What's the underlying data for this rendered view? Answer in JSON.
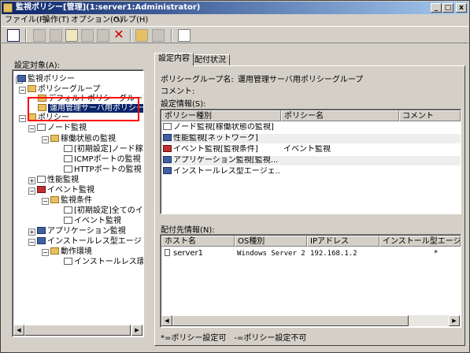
{
  "window": {
    "title": "監視ポリシー[管理](1:server1:Administrator)"
  },
  "menu": [
    "ファイル(F)",
    "操作(T)",
    "オプション(O)",
    "ヘルプ(H)"
  ],
  "left": {
    "label": "設定対象(A):"
  },
  "tree": {
    "root": "監視ポリシー",
    "policy_group": "ポリシーグループ",
    "default_group": "デフォルトポリシーグループ",
    "ops_group": "運用管理サーバ用ポリシー",
    "policy": "ポリシー",
    "node_monitor": "ノード監視",
    "operating": "稼働状態の監視",
    "init_node": "[初期設定]ノード稼",
    "icmp": "ICMPポートの監視",
    "http": "HTTPポートの監視",
    "perf": "性能監視",
    "event": "イベント監視",
    "monitor_cond": "監視条件",
    "init_all": "[初期設定]全てのイ",
    "event_monitor": "イベント監視",
    "app": "アプリケーション監視",
    "install_less": "インストールレス型エージ",
    "action_env": "動作環境",
    "install_less_item": "インストールレス環"
  },
  "tabs": [
    "設定内容",
    "配付状況"
  ],
  "detail": {
    "group_name_label": "ポリシーグループ名:",
    "group_name_value": "運用管理サーバ用ポリシーグループ",
    "comment_label": "コメント:",
    "settings_label": "設定情報(S):",
    "settings_columns": [
      "ポリシー種別",
      "ポリシー名",
      "コメント"
    ],
    "settings_rows": [
      {
        "type": "ノード監視[稼働状態の監視]",
        "name": "",
        "icon": "node-icon"
      },
      {
        "type": "性能監視[ネットワーク]",
        "name": "",
        "icon": "perf-icon"
      },
      {
        "type": "イベント監視[監視条件]",
        "name": "イベント監視",
        "icon": "event-icon"
      },
      {
        "type": "アプリケーション監視[監視...",
        "name": "",
        "icon": "app-icon"
      },
      {
        "type": "インストールレス型エージェ...",
        "name": "",
        "icon": "agentless-icon"
      }
    ],
    "dist_label": "配付先情報(N):",
    "dist_columns": [
      "ホスト名",
      "OS種別",
      "IPアドレス",
      "インストール型エージェ"
    ],
    "dist_rows": [
      {
        "host": "server1",
        "os": "Windows Server 2...",
        "ip": "192.168.1.2",
        "agent": "*"
      }
    ],
    "legend": "*=ポリシー設定可　-=ポリシー設定不可"
  }
}
